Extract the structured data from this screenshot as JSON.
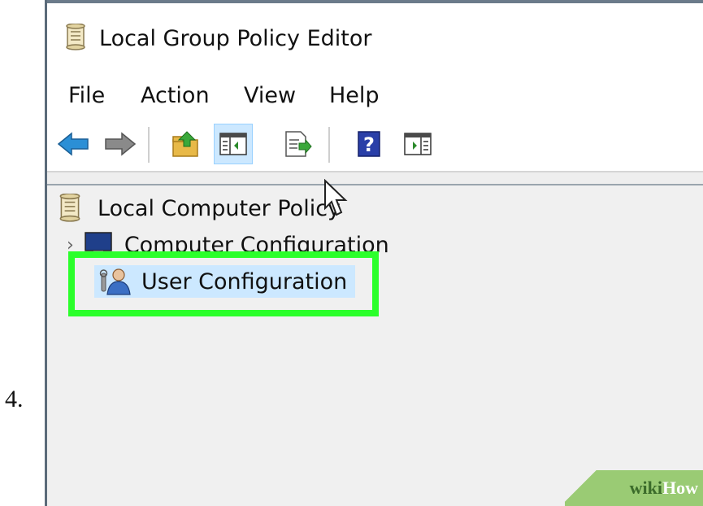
{
  "step": {
    "number": "4."
  },
  "window": {
    "title": "Local Group Policy Editor"
  },
  "menu": {
    "items": [
      "File",
      "Action",
      "View",
      "Help"
    ]
  },
  "toolbar": {
    "buttons": [
      "back-arrow-icon",
      "forward-arrow-icon",
      "up-folder-icon",
      "show-hide-tree-icon",
      "export-list-icon",
      "help-icon",
      "show-hide-action-pane-icon"
    ],
    "active": "show-hide-tree-icon"
  },
  "tree": {
    "root": {
      "label": "Local Computer Policy"
    },
    "children": [
      {
        "label": "Computer Configuration",
        "expander": "›"
      },
      {
        "label": "User Configuration",
        "selected": true
      }
    ]
  },
  "watermark": {
    "wiki": "wiki",
    "how": "How"
  },
  "colors": {
    "highlight": "#2bff2b",
    "selection": "#cce8ff"
  }
}
